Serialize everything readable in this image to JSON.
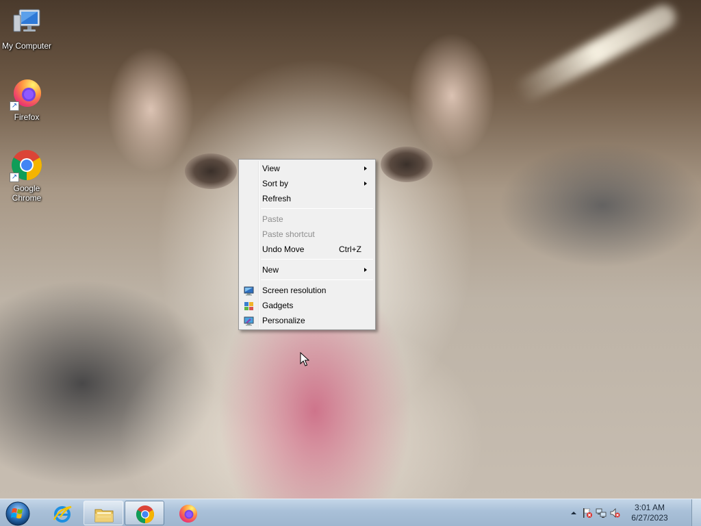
{
  "desktop": {
    "icons": [
      {
        "label": "My Computer",
        "icon": "computer-icon"
      },
      {
        "label": "Firefox",
        "icon": "firefox-icon"
      },
      {
        "label": "Google Chrome",
        "icon": "chrome-icon"
      }
    ]
  },
  "context_menu": {
    "items": [
      {
        "label": "View",
        "submenu": true,
        "enabled": true
      },
      {
        "label": "Sort by",
        "submenu": true,
        "enabled": true
      },
      {
        "label": "Refresh",
        "enabled": true
      },
      {
        "label": "Paste",
        "enabled": false
      },
      {
        "label": "Paste shortcut",
        "enabled": false
      },
      {
        "label": "Undo Move",
        "shortcut": "Ctrl+Z",
        "enabled": true
      },
      {
        "label": "New",
        "submenu": true,
        "enabled": true
      },
      {
        "label": "Screen resolution",
        "icon": "screen-resolution-icon",
        "enabled": true
      },
      {
        "label": "Gadgets",
        "icon": "gadgets-icon",
        "enabled": true
      },
      {
        "label": "Personalize",
        "icon": "personalize-icon",
        "enabled": true
      }
    ]
  },
  "taskbar": {
    "start": "windows-start-orb-icon",
    "buttons": [
      {
        "icon": "internet-explorer-icon",
        "state": "pinned"
      },
      {
        "icon": "windows-explorer-icon",
        "state": "pinned"
      },
      {
        "icon": "chrome-icon",
        "state": "active"
      },
      {
        "icon": "firefox-icon",
        "state": "pinned"
      }
    ],
    "tray": {
      "icons": [
        "show-hidden-icons-arrow",
        "action-center-flag-icon",
        "network-icon",
        "volume-muted-icon"
      ],
      "time": "3:01 AM",
      "date": "6/27/2023"
    }
  },
  "colors": {
    "menu_bg": "#f0f0f0",
    "menu_disabled_text": "#8d8d8d",
    "taskbar_top": "#c4d6e8",
    "taskbar_bottom": "#9eb6cf"
  }
}
